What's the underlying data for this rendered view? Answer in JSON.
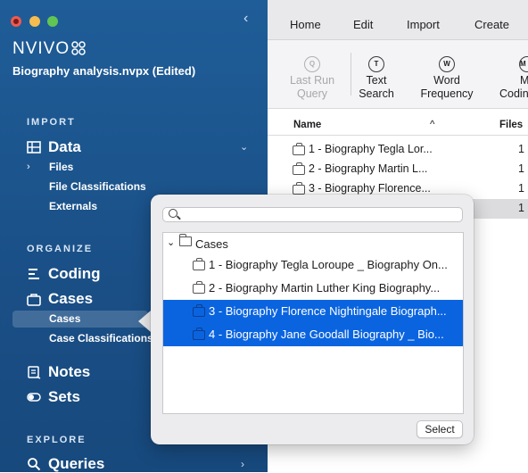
{
  "app": {
    "logo_text": "NVIVO",
    "project_title": "Biography analysis.nvpx (Edited)"
  },
  "sidebar": {
    "sections": {
      "import": "IMPORT",
      "organize": "ORGANIZE",
      "explore": "EXPLORE"
    },
    "items": {
      "data": "Data",
      "files": "Files",
      "file_classifications": "File Classifications",
      "externals": "Externals",
      "coding": "Coding",
      "cases": "Cases",
      "cases_sub": "Cases",
      "case_classifications": "Case Classifications",
      "notes": "Notes",
      "sets": "Sets",
      "queries": "Queries"
    }
  },
  "menubar": {
    "items": [
      "Home",
      "Edit",
      "Import",
      "Create"
    ]
  },
  "ribbon": {
    "last_run_query": [
      "Last Run",
      "Query"
    ],
    "text_search": [
      "Text",
      "Search"
    ],
    "word_frequency": [
      "Word",
      "Frequency"
    ],
    "matrix_coding": [
      "M",
      "Codin"
    ]
  },
  "table": {
    "headers": {
      "name": "Name",
      "files": "Files"
    },
    "rows": [
      {
        "name": "1 - Biography Tegla Lor...",
        "files": "1"
      },
      {
        "name": "2 - Biography Martin L...",
        "files": "1"
      },
      {
        "name": "3 - Biography Florence...",
        "files": "1"
      },
      {
        "name": "",
        "files": "1"
      }
    ]
  },
  "popover": {
    "search_placeholder": "",
    "root_folder": "Cases",
    "items": [
      {
        "label": "1 - Biography Tegla Loroupe _  Biography On...",
        "selected": false
      },
      {
        "label": "2 - Biography Martin Luther King Biography...",
        "selected": false
      },
      {
        "label": "3 - Biography Florence Nightingale Biograph...",
        "selected": true
      },
      {
        "label": "4 - Biography Jane Goodall Biography _  Bio...",
        "selected": true
      }
    ],
    "select_button": "Select"
  },
  "colors": {
    "sidebar": "#1f5d98",
    "selection": "#0a64e0"
  }
}
